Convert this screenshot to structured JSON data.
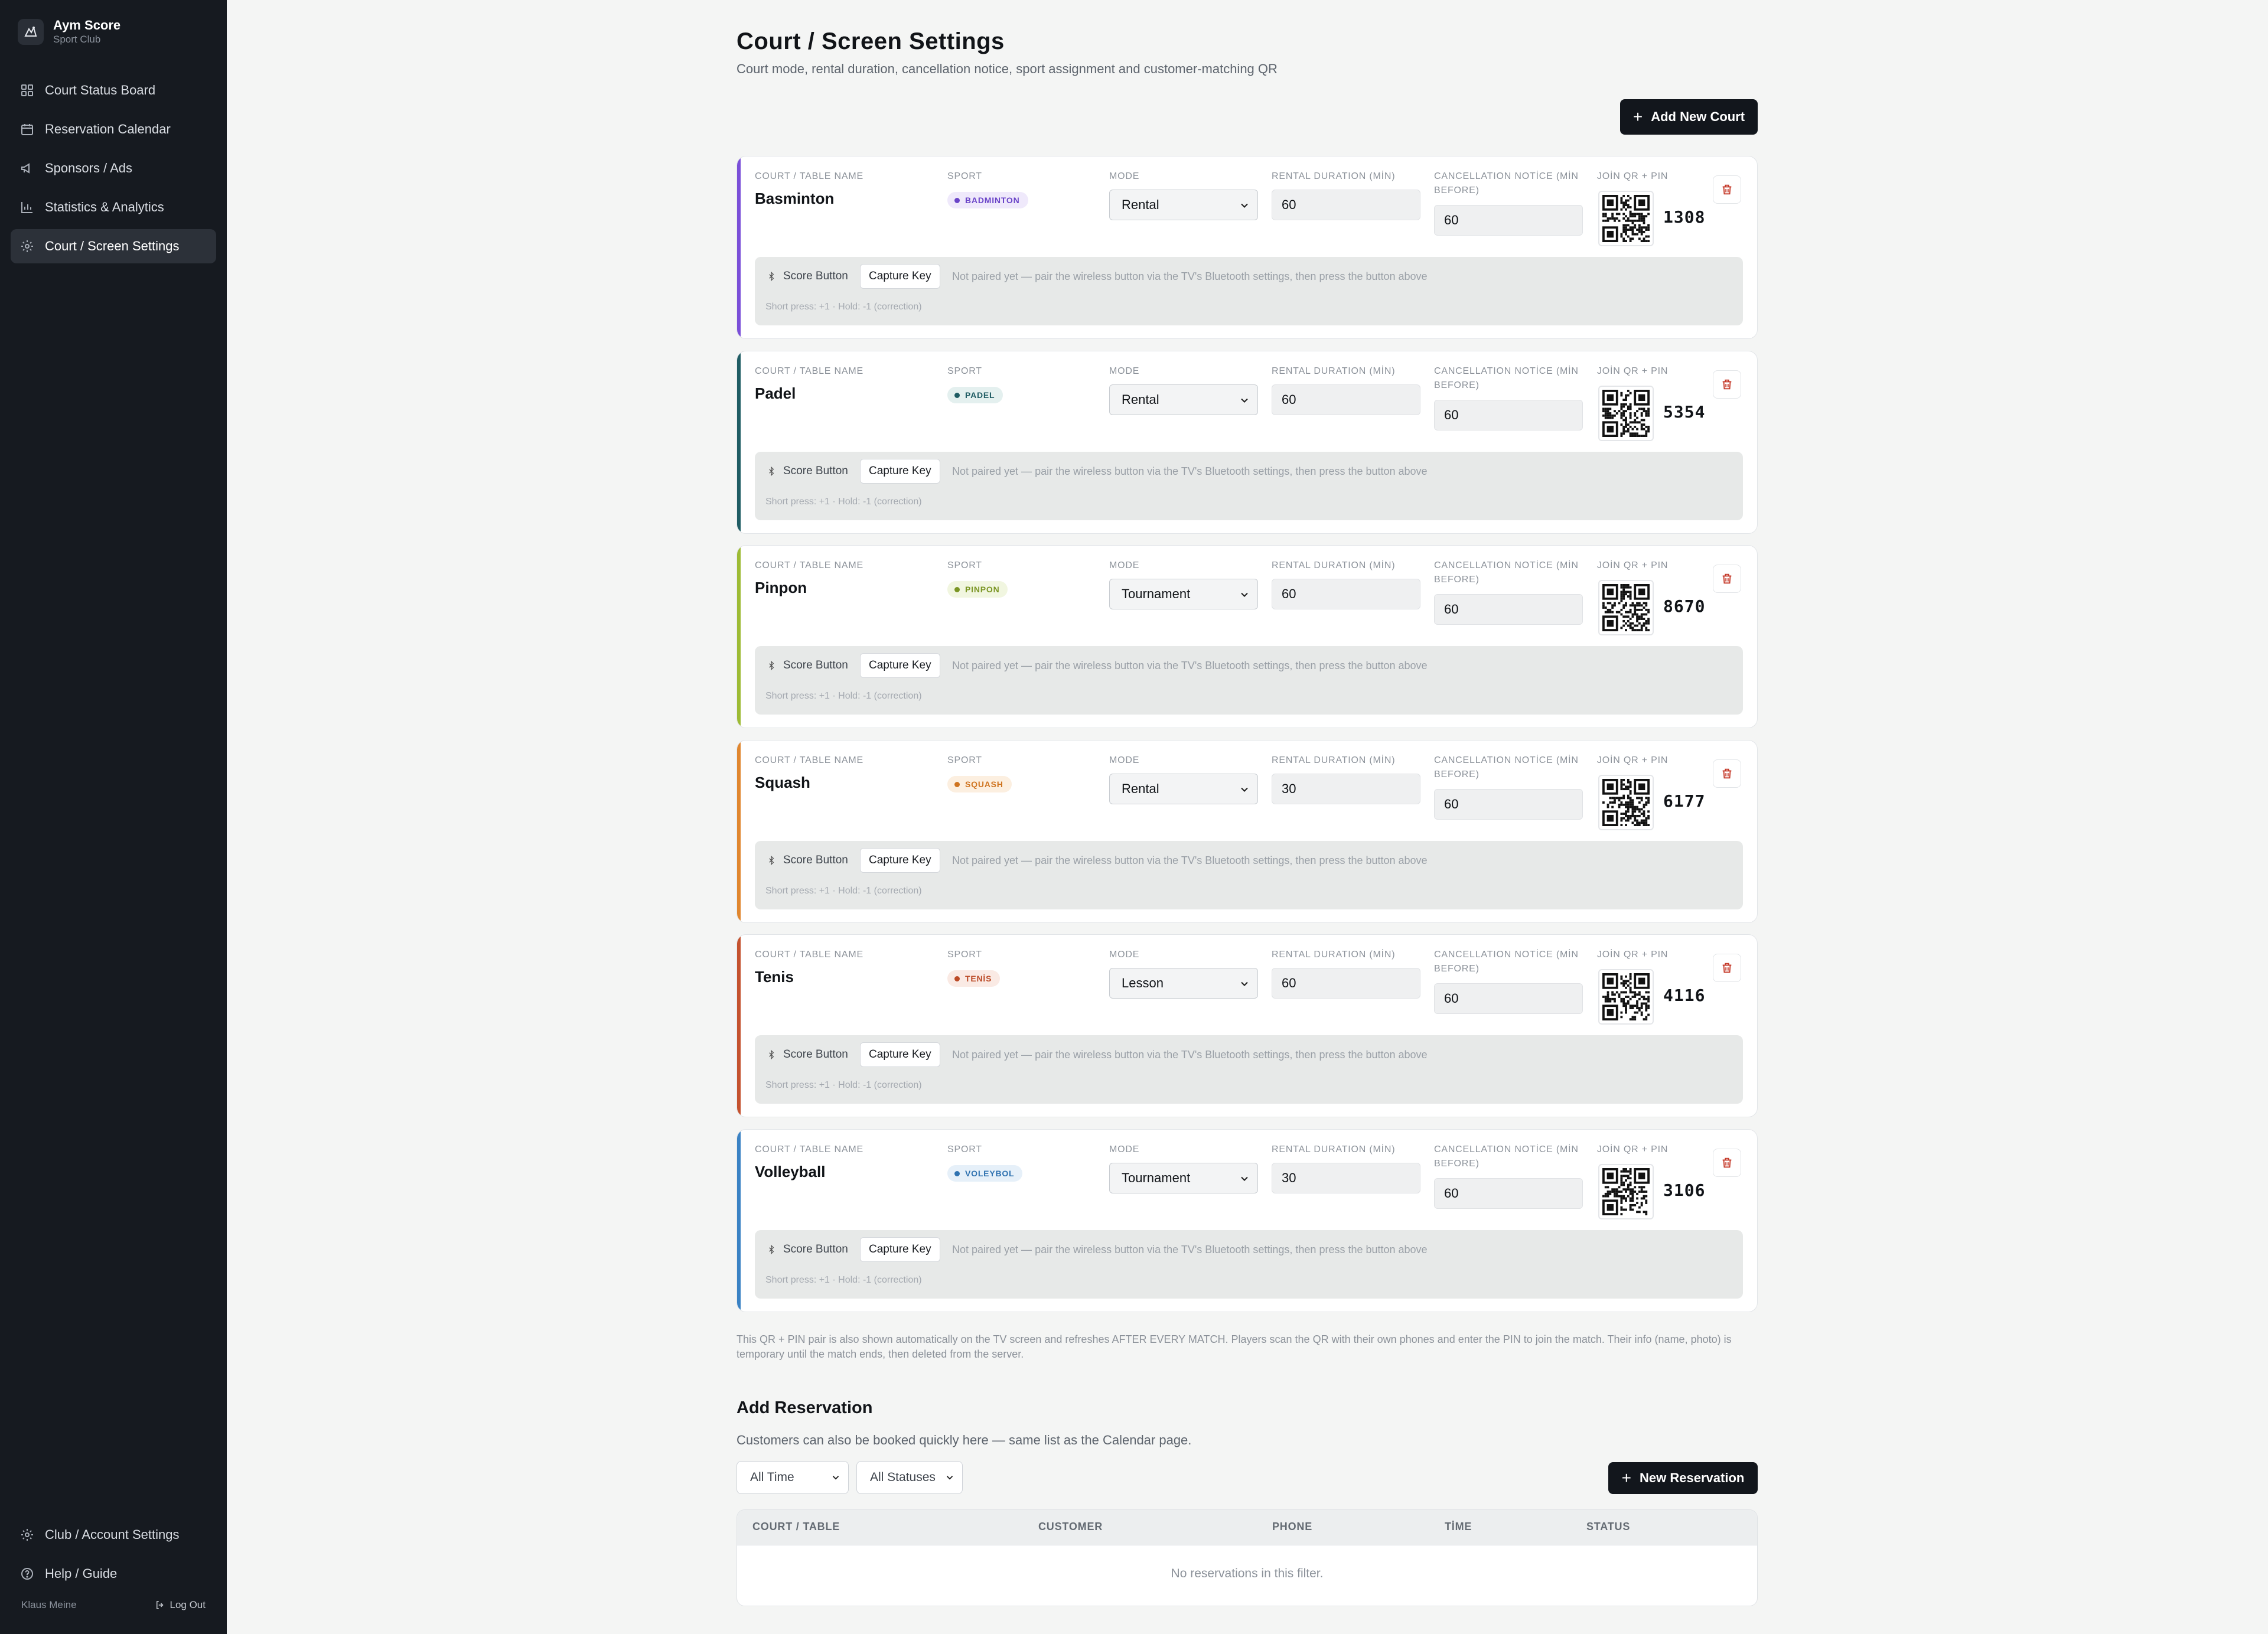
{
  "brand": {
    "name": "Aym Score",
    "subtitle": "Sport Club"
  },
  "nav": [
    {
      "label": "Court Status Board",
      "icon": "grid-icon",
      "active": false
    },
    {
      "label": "Reservation Calendar",
      "icon": "calendar-icon",
      "active": false
    },
    {
      "label": "Sponsors / Ads",
      "icon": "megaphone-icon",
      "active": false
    },
    {
      "label": "Statistics & Analytics",
      "icon": "bar-chart-icon",
      "active": false
    },
    {
      "label": "Court / Screen Settings",
      "icon": "gear-icon",
      "active": true
    }
  ],
  "nav_bottom": [
    {
      "label": "Club / Account Settings",
      "icon": "gear-icon"
    },
    {
      "label": "Help / Guide",
      "icon": "help-icon"
    }
  ],
  "user": {
    "name": "Klaus Meine",
    "logout": "Log Out"
  },
  "page": {
    "title": "Court / Screen Settings",
    "subtitle": "Court mode, rental duration, cancellation notice, sport assignment and customer-matching QR",
    "add_court": "Add New Court"
  },
  "labels": {
    "name": "COURT / TABLE NAME",
    "sport": "SPORT",
    "mode": "MODE",
    "rental": "RENTAL DURATION (MİN)",
    "cancel1": "CANCELLATION NOTİCE (MİN",
    "cancel2": "BEFORE)",
    "qr": "JOİN QR + PIN",
    "score_button": "Score Button",
    "capture_key": "Capture Key",
    "pair_hint": "Not paired yet — pair the wireless button via the TV's Bluetooth settings, then press the button above",
    "short_press": "Short press: +1 · Hold: -1 (correction)"
  },
  "courts": [
    {
      "name": "Basminton",
      "sport": "BADMINTON",
      "mode": "Rental",
      "rental": "60",
      "cancel": "60",
      "pin": "1308",
      "accent": "#7a4fd8",
      "badge_bg": "#efe9fb",
      "badge_fg": "#6a44c8"
    },
    {
      "name": "Padel",
      "sport": "PADEL",
      "mode": "Rental",
      "rental": "60",
      "cancel": "60",
      "pin": "5354",
      "accent": "#1f5c63",
      "badge_bg": "#e4f0ef",
      "badge_fg": "#1f5c63"
    },
    {
      "name": "Pinpon",
      "sport": "PINPON",
      "mode": "Tournament",
      "rental": "60",
      "cancel": "60",
      "pin": "8670",
      "accent": "#9dbb34",
      "badge_bg": "#f1f6e0",
      "badge_fg": "#7a9523"
    },
    {
      "name": "Squash",
      "sport": "SQUASH",
      "mode": "Rental",
      "rental": "30",
      "cancel": "60",
      "pin": "6177",
      "accent": "#e0862e",
      "badge_bg": "#fcefe0",
      "badge_fg": "#cf7420"
    },
    {
      "name": "Tenis",
      "sport": "TENİS",
      "mode": "Lesson",
      "rental": "60",
      "cancel": "60",
      "pin": "4116",
      "accent": "#c4522e",
      "badge_bg": "#faeae4",
      "badge_fg": "#bb4a26"
    },
    {
      "name": "Volleyball",
      "sport": "VOLEYBOL",
      "mode": "Tournament",
      "rental": "30",
      "cancel": "60",
      "pin": "3106",
      "accent": "#3a82c4",
      "badge_bg": "#e6f0f9",
      "badge_fg": "#2f72b0"
    }
  ],
  "qr_note": "This QR + PIN pair is also shown automatically on the TV screen and refreshes AFTER EVERY MATCH. Players scan the QR with their own phones and enter the PIN to join the match. Their info (name, photo) is temporary until the match ends, then deleted from the server.",
  "reservations": {
    "title": "Add Reservation",
    "subtitle": "Customers can also be booked quickly here — same list as the Calendar page.",
    "filter_time": "All Time",
    "filter_status": "All Statuses",
    "new_button": "New Reservation",
    "columns": [
      "COURT / TABLE",
      "CUSTOMER",
      "PHONE",
      "TİME",
      "STATUS"
    ],
    "empty": "No reservations in this filter."
  }
}
